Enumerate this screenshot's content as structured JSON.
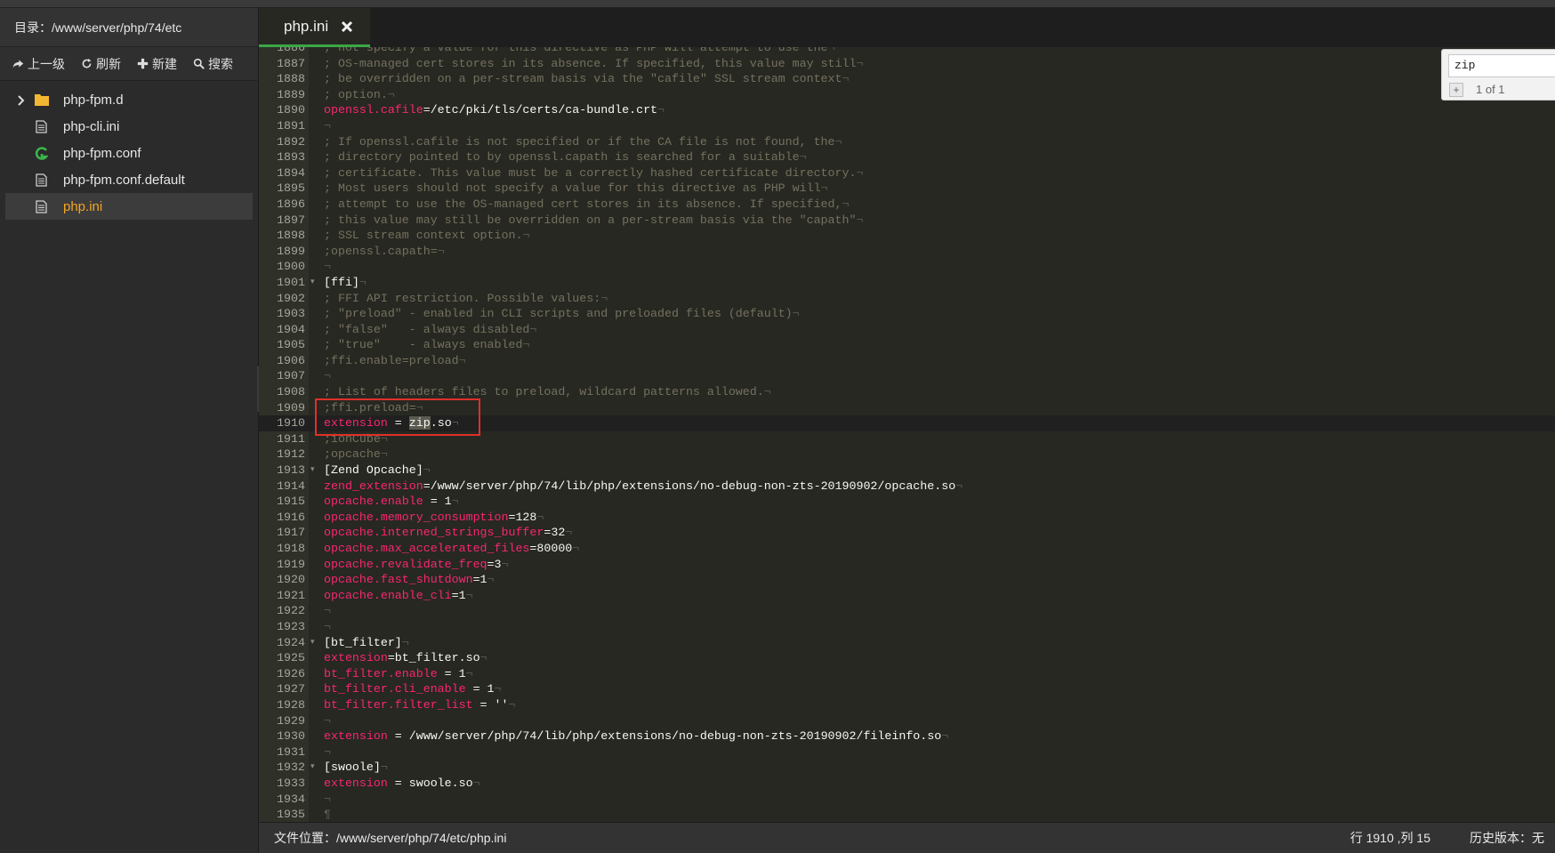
{
  "sidebar": {
    "dir_label": "目录：/www/server/php/74/etc",
    "toolbar": {
      "up": "上一级",
      "refresh": "刷新",
      "new": "新建",
      "search": "搜索"
    },
    "files": [
      {
        "name": "php-fpm.d",
        "icon": "folder-icon"
      },
      {
        "name": "php-cli.ini",
        "icon": "file-icon"
      },
      {
        "name": "php-fpm.conf",
        "icon": "config-file-icon"
      },
      {
        "name": "php-fpm.conf.default",
        "icon": "file-icon"
      },
      {
        "name": "php.ini",
        "icon": "file-icon",
        "active": true
      }
    ]
  },
  "tab": {
    "label": "php.ini"
  },
  "search": {
    "query": "zip",
    "plus": "+",
    "count": "1 of 1"
  },
  "editor": {
    "lines": [
      {
        "n": "1886",
        "t": "c",
        "text": "; not specify a value for this directive as PHP will attempt to use the"
      },
      {
        "n": "1887",
        "t": "c",
        "text": "; OS-managed cert stores in its absence. If specified, this value may still"
      },
      {
        "n": "1888",
        "t": "c",
        "text": "; be overridden on a per-stream basis via the \"cafile\" SSL stream context"
      },
      {
        "n": "1889",
        "t": "c",
        "text": "; option."
      },
      {
        "n": "1890",
        "t": "kv",
        "key": "openssl.cafile",
        "val": "=/etc/pki/tls/certs/ca-bundle.crt"
      },
      {
        "n": "1891",
        "t": "e"
      },
      {
        "n": "1892",
        "t": "c",
        "text": "; If openssl.cafile is not specified or if the CA file is not found, the"
      },
      {
        "n": "1893",
        "t": "c",
        "text": "; directory pointed to by openssl.capath is searched for a suitable"
      },
      {
        "n": "1894",
        "t": "c",
        "text": "; certificate. This value must be a correctly hashed certificate directory."
      },
      {
        "n": "1895",
        "t": "c",
        "text": "; Most users should not specify a value for this directive as PHP will"
      },
      {
        "n": "1896",
        "t": "c",
        "text": "; attempt to use the OS-managed cert stores in its absence. If specified,"
      },
      {
        "n": "1897",
        "t": "c",
        "text": "; this value may still be overridden on a per-stream basis via the \"capath\""
      },
      {
        "n": "1898",
        "t": "c",
        "text": "; SSL stream context option."
      },
      {
        "n": "1899",
        "t": "c",
        "text": ";openssl.capath="
      },
      {
        "n": "1900",
        "t": "e"
      },
      {
        "n": "1901",
        "t": "s",
        "text": "[ffi]",
        "fold": true
      },
      {
        "n": "1902",
        "t": "c",
        "text": "; FFI API restriction. Possible values:"
      },
      {
        "n": "1903",
        "t": "c",
        "text": "; \"preload\" - enabled in CLI scripts and preloaded files (default)"
      },
      {
        "n": "1904",
        "t": "c",
        "text": "; \"false\"   - always disabled"
      },
      {
        "n": "1905",
        "t": "c",
        "text": "; \"true\"    - always enabled"
      },
      {
        "n": "1906",
        "t": "c",
        "text": ";ffi.enable=preload"
      },
      {
        "n": "1907",
        "t": "e"
      },
      {
        "n": "1908",
        "t": "c",
        "text": "; List of headers files to preload, wildcard patterns allowed."
      },
      {
        "n": "1909",
        "t": "c",
        "text": ";ffi.preload="
      },
      {
        "n": "1910",
        "t": "ext",
        "key": "extension",
        "mid": " = ",
        "hl": "zip",
        "rest": ".so",
        "cur": true
      },
      {
        "n": "1911",
        "t": "c",
        "text": ";ionCube"
      },
      {
        "n": "1912",
        "t": "c",
        "text": ";opcache"
      },
      {
        "n": "1913",
        "t": "s",
        "text": "[Zend Opcache]",
        "fold": true
      },
      {
        "n": "1914",
        "t": "kv",
        "key": "zend_extension",
        "val": "=/www/server/php/74/lib/php/extensions/no-debug-non-zts-20190902/opcache.so"
      },
      {
        "n": "1915",
        "t": "kv",
        "key": "opcache.enable",
        "val": " = 1"
      },
      {
        "n": "1916",
        "t": "kv",
        "key": "opcache.memory_consumption",
        "val": "=128"
      },
      {
        "n": "1917",
        "t": "kv",
        "key": "opcache.interned_strings_buffer",
        "val": "=32"
      },
      {
        "n": "1918",
        "t": "kv",
        "key": "opcache.max_accelerated_files",
        "val": "=80000"
      },
      {
        "n": "1919",
        "t": "kv",
        "key": "opcache.revalidate_freq",
        "val": "=3"
      },
      {
        "n": "1920",
        "t": "kv",
        "key": "opcache.fast_shutdown",
        "val": "=1"
      },
      {
        "n": "1921",
        "t": "kv",
        "key": "opcache.enable_cli",
        "val": "=1"
      },
      {
        "n": "1922",
        "t": "e"
      },
      {
        "n": "1923",
        "t": "e"
      },
      {
        "n": "1924",
        "t": "s",
        "text": "[bt_filter]",
        "fold": true
      },
      {
        "n": "1925",
        "t": "kv",
        "key": "extension",
        "val": "=bt_filter.so"
      },
      {
        "n": "1926",
        "t": "kv",
        "key": "bt_filter.enable",
        "val": " = 1"
      },
      {
        "n": "1927",
        "t": "kv",
        "key": "bt_filter.cli_enable",
        "val": " = 1"
      },
      {
        "n": "1928",
        "t": "kv",
        "key": "bt_filter.filter_list",
        "val": " = ''"
      },
      {
        "n": "1929",
        "t": "e"
      },
      {
        "n": "1930",
        "t": "kv",
        "key": "extension",
        "val": " = /www/server/php/74/lib/php/extensions/no-debug-non-zts-20190902/fileinfo.so"
      },
      {
        "n": "1931",
        "t": "e"
      },
      {
        "n": "1932",
        "t": "s",
        "text": "[swoole]",
        "fold": true
      },
      {
        "n": "1933",
        "t": "kv",
        "key": "extension",
        "val": " = swoole.so"
      },
      {
        "n": "1934",
        "t": "e"
      },
      {
        "n": "1935",
        "t": "end"
      }
    ]
  },
  "status": {
    "path": "文件位置：/www/server/php/74/etc/php.ini",
    "position": "行 1910 ,列 15",
    "history": "历史版本：无"
  }
}
